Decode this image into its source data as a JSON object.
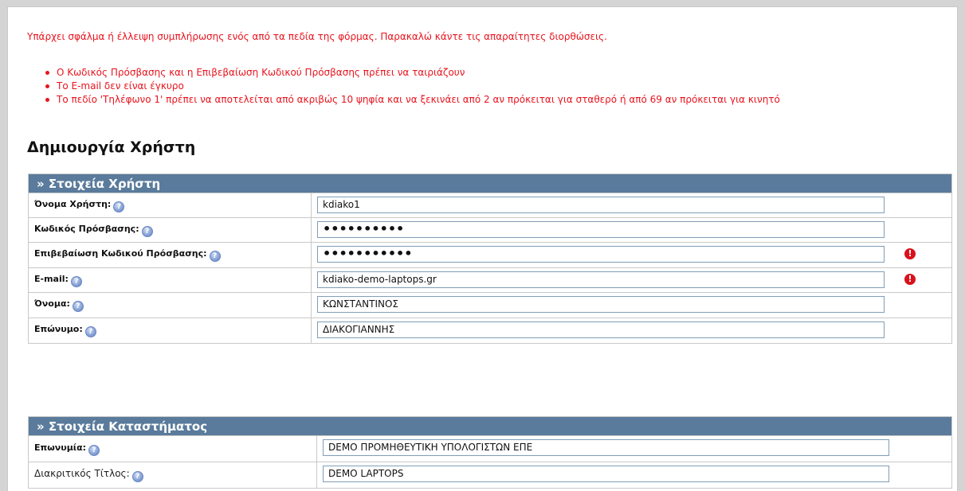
{
  "form_error": {
    "message": "Υπάρχει σφάλμα ή έλλειψη συμπλήρωσης ενός από τα πεδία της φόρμας. Παρακαλώ κάντε τις απαραίτητες διορθώσεις.",
    "items": [
      "Ο Κωδικός Πρόσβασης και η Επιβεβαίωση Κωδικού Πρόσβασης πρέπει να ταιριάζουν",
      "Το E-mail δεν είναι έγκυρο",
      "Το πεδίο 'Τηλέφωνο 1' πρέπει να αποτελείται από ακριβώς 10 ψηφία και να ξεκινάει από 2 αν πρόκειται για σταθερό ή από 69 αν πρόκειται για κινητό"
    ]
  },
  "page_title": "Δημιουργία Χρήστη",
  "user_section": {
    "title": "» Στοιχεία Χρήστη",
    "fields": {
      "username": {
        "label": "Όνομα Χρήστη:",
        "value": "kdiako1"
      },
      "password": {
        "label": "Κωδικός Πρόσβασης:",
        "value": "••••••••••"
      },
      "password_confirm": {
        "label": "Επιβεβαίωση Κωδικού Πρόσβασης:",
        "value": "•••••••••••"
      },
      "email": {
        "label": "E-mail:",
        "value": "kdiako-demo-laptops.gr"
      },
      "first_name": {
        "label": "Όνομα:",
        "value": "ΚΩΝΣΤΑΝΤΙΝΟΣ"
      },
      "last_name": {
        "label": "Επώνυμο:",
        "value": "ΔΙΑΚΟΓΙΑΝΝΗΣ"
      }
    }
  },
  "store_section": {
    "title": "» Στοιχεία Καταστήματος",
    "fields": {
      "company_name": {
        "label": "Επωνυμία:",
        "value": "DEMO ΠΡΟΜΗΘΕΥΤΙΚΗ ΥΠΟΛΟΓΙΣΤΩΝ ΕΠΕ"
      },
      "trade_name": {
        "label": "Διακριτικός Τίτλος:",
        "value": "DEMO LAPTOPS"
      }
    }
  },
  "icons": {
    "help": "help-icon",
    "error": "error-icon"
  },
  "colors": {
    "error_text": "#e8141e",
    "section_header": "#5a7b9b",
    "error_icon": "#d8121b"
  }
}
